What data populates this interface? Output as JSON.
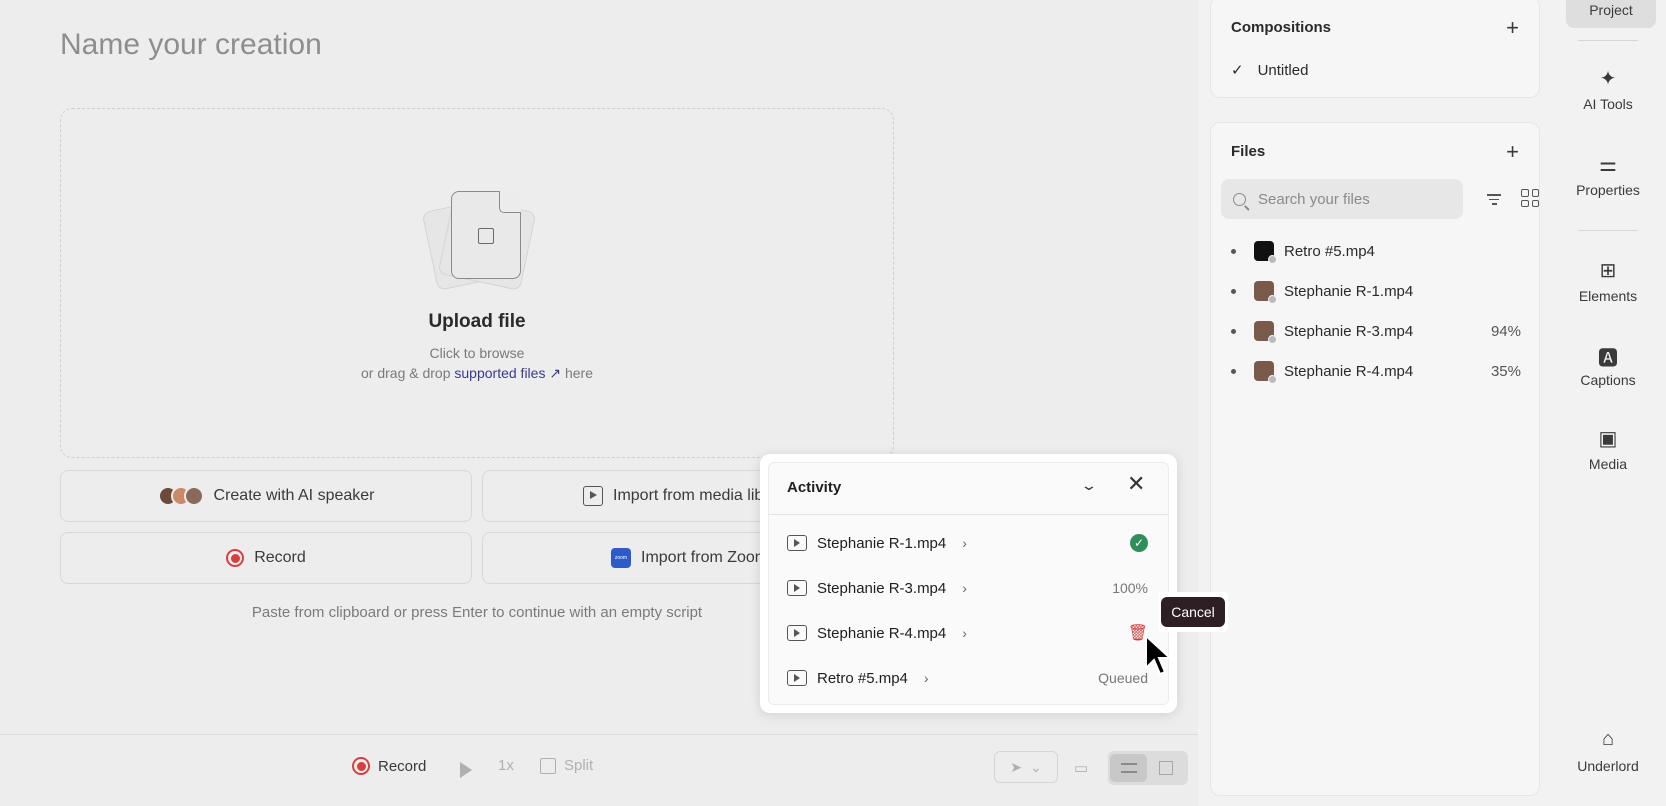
{
  "main": {
    "title_placeholder": "Name your creation",
    "upload": {
      "title": "Upload file",
      "line1": "Click to browse",
      "line2_prefix": "or drag & drop",
      "line2_link": "supported files ↗",
      "line2_suffix": "here"
    },
    "options": {
      "ai_speaker": "Create with AI speaker",
      "media_library": "Import from media libr",
      "record": "Record",
      "zoom": "Import from Zoom",
      "zoom_icon": "zoom"
    },
    "paste_hint": "Paste from clipboard or press Enter to continue with an empty script"
  },
  "bottom_bar": {
    "record": "Record",
    "speed": "1x",
    "split": "Split"
  },
  "compositions": {
    "header": "Compositions",
    "items": [
      {
        "label": "Untitled",
        "checked": true
      }
    ]
  },
  "files": {
    "header": "Files",
    "search_placeholder": "Search your files",
    "items": [
      {
        "name": "Retro #5.mp4",
        "progress": ""
      },
      {
        "name": "Stephanie R-1.mp4",
        "progress": ""
      },
      {
        "name": "Stephanie R-3.mp4",
        "progress": "94%"
      },
      {
        "name": "Stephanie R-4.mp4",
        "progress": "35%"
      }
    ]
  },
  "rail": {
    "project": "Project",
    "ai_tools": "AI Tools",
    "properties": "Properties",
    "elements": "Elements",
    "captions": "Captions",
    "media": "Media",
    "underlord": "Underlord"
  },
  "activity": {
    "title": "Activity",
    "rows": [
      {
        "name": "Stephanie R-1.mp4",
        "status": "done"
      },
      {
        "name": "Stephanie R-3.mp4",
        "status": "100%"
      },
      {
        "name": "Stephanie R-4.mp4",
        "status": "delete"
      },
      {
        "name": "Retro #5.mp4",
        "status": "Queued"
      }
    ],
    "tooltip": "Cancel"
  },
  "colors": {
    "accent_red": "#d84040",
    "success_green": "#2f8f5a",
    "tooltip_bg": "#2d1f24",
    "zoom_blue": "#2d5cc8"
  }
}
